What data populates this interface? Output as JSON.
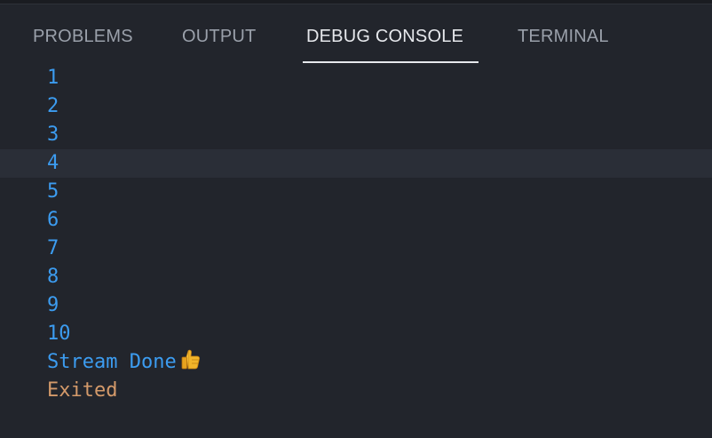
{
  "tabs": [
    {
      "label": "PROBLEMS",
      "active": false
    },
    {
      "label": "OUTPUT",
      "active": false
    },
    {
      "label": "DEBUG CONSOLE",
      "active": true
    },
    {
      "label": "TERMINAL",
      "active": false
    }
  ],
  "console": {
    "lines": [
      "1",
      "2",
      "3",
      "4",
      "5",
      "6",
      "7",
      "8",
      "9",
      "10"
    ],
    "done_text": "Stream Done",
    "done_icon": "thumbs-up-icon",
    "exit_text": "Exited",
    "highlighted_line": "4"
  },
  "colors": {
    "background": "#22252c",
    "output_text": "#3c9cf0",
    "exit_text": "#d49a6a",
    "active_tab": "#e6e8ec",
    "inactive_tab": "#9aa0aa",
    "highlight_row": "#2a2e37"
  }
}
